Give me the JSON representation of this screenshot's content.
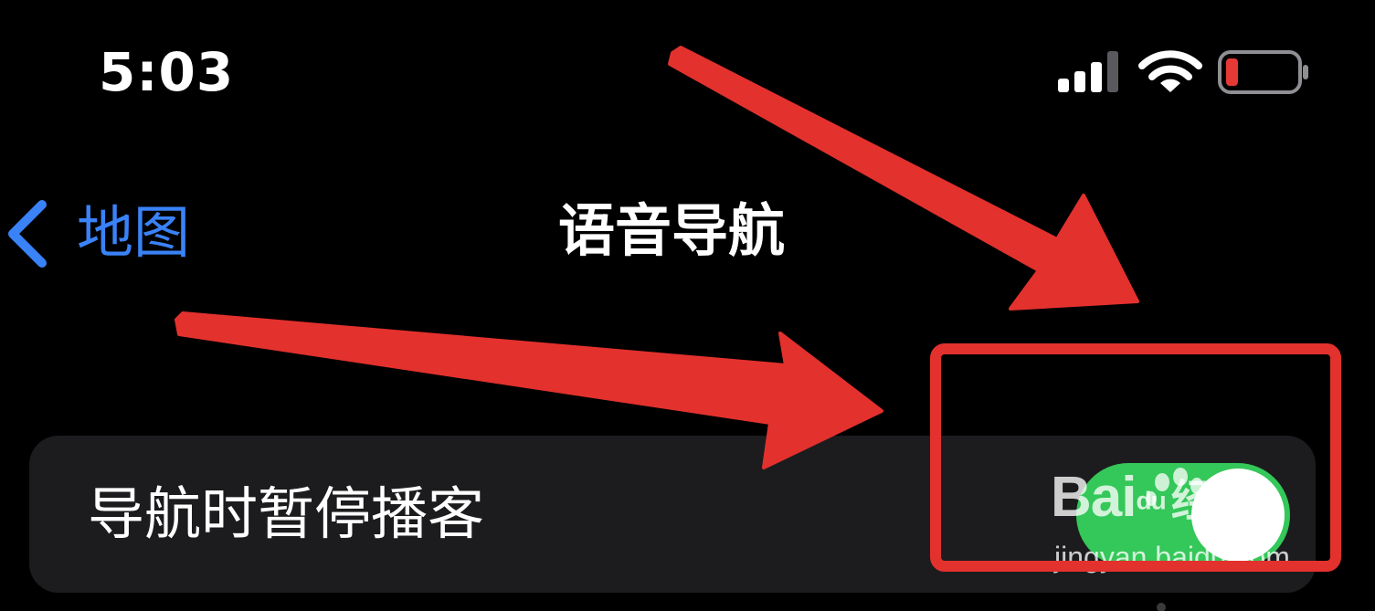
{
  "status_bar": {
    "time": "5:03",
    "icons": [
      "signal-icon",
      "wifi-icon",
      "battery-low-icon"
    ],
    "battery_color": "#e53935"
  },
  "nav_bar": {
    "back_label": "地图",
    "title": "语音导航",
    "accent_color": "#3a82f7"
  },
  "settings": {
    "rows": [
      {
        "label": "导航时暂停播客",
        "toggle_on": true
      }
    ],
    "toggle_on_color": "#34c759"
  },
  "annotations": {
    "arrow_color": "#e3312d",
    "highlight_color": "#e3312d"
  },
  "watermark": {
    "brand_1": "Bai",
    "brand_2": "du",
    "suffix": "经验",
    "url": "jingyan.baidu.com"
  }
}
